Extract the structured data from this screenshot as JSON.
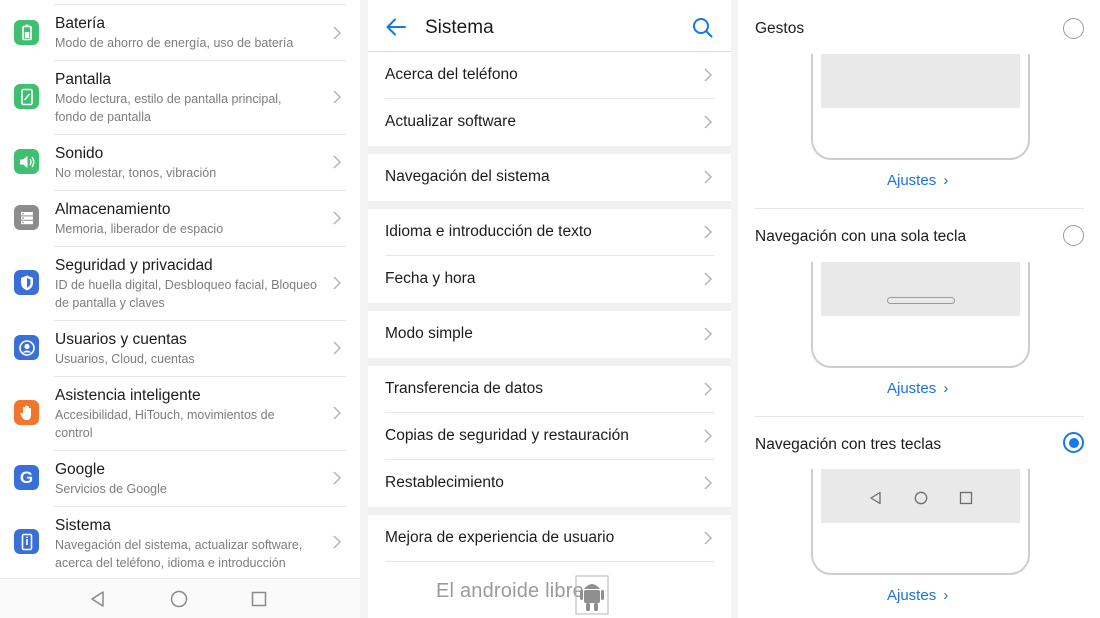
{
  "colors": {
    "accent": "#1478e8",
    "link": "#1d72d6"
  },
  "settings": {
    "items": [
      {
        "title": "Batería",
        "subtitle": "Modo de ahorro de energía, uso de batería",
        "icon": "battery-icon",
        "color": "#3fbf6f"
      },
      {
        "title": "Pantalla",
        "subtitle": "Modo lectura, estilo de pantalla principal, fondo de pantalla",
        "icon": "display-icon",
        "color": "#3fbf6f"
      },
      {
        "title": "Sonido",
        "subtitle": "No molestar, tonos, vibración",
        "icon": "speaker-icon",
        "color": "#3fbf6f"
      },
      {
        "title": "Almacenamiento",
        "subtitle": "Memoria, liberador de espacio",
        "icon": "storage-icon",
        "color": "#8c8c8c"
      },
      {
        "title": "Seguridad y privacidad",
        "subtitle": "ID de huella digital, Desbloqueo facial, Bloqueo de pantalla y claves",
        "icon": "shield-icon",
        "color": "#3a6fd8"
      },
      {
        "title": "Usuarios y cuentas",
        "subtitle": "Usuarios, Cloud, cuentas",
        "icon": "user-icon",
        "color": "#3a6fd8"
      },
      {
        "title": "Asistencia inteligente",
        "subtitle": "Accesibilidad, HiTouch, movimientos de control",
        "icon": "hand-icon",
        "color": "#f0762e"
      },
      {
        "title": "Google",
        "subtitle": "Servicios de Google",
        "icon": "google-icon",
        "color": "#3a6fd8"
      },
      {
        "title": "Sistema",
        "subtitle": "Navegación del sistema, actualizar software, acerca del teléfono, idioma e introducción",
        "icon": "phone-icon",
        "color": "#3a6fd8"
      }
    ]
  },
  "navbar": {
    "back": "back-triangle-icon",
    "home": "home-circle-icon",
    "recents": "recents-square-icon"
  },
  "sistema": {
    "title": "Sistema",
    "items": [
      "Acerca del teléfono",
      "Actualizar software",
      "Navegación del sistema",
      "Idioma e introducción de texto",
      "Fecha y hora",
      "Modo simple",
      "Transferencia de datos",
      "Copias de seguridad y restauración",
      "Restablecimiento",
      "Mejora de experiencia de usuario"
    ],
    "watermark": "El androide libre"
  },
  "navigation": {
    "options": [
      {
        "label": "Gestos",
        "selected": false,
        "settings_link": "Ajustes"
      },
      {
        "label": "Navegación con una sola tecla",
        "selected": false,
        "settings_link": "Ajustes"
      },
      {
        "label": "Navegación con tres teclas",
        "selected": true,
        "settings_link": "Ajustes"
      }
    ]
  }
}
